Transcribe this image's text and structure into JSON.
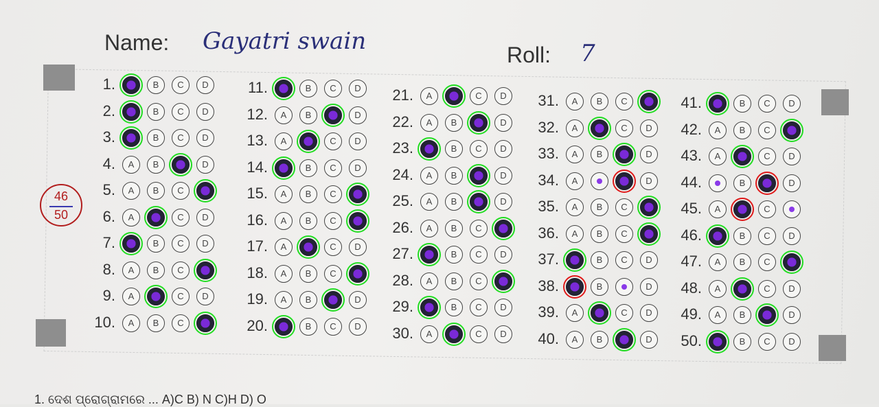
{
  "header": {
    "name_label": "Name:",
    "name_value": "Gayatri swain",
    "roll_label": "Roll:",
    "roll_value": "7"
  },
  "score": {
    "obtained": "46",
    "total": "50"
  },
  "options": [
    "A",
    "B",
    "C",
    "D"
  ],
  "questions": [
    {
      "n": "1.",
      "f": "A",
      "s": "correct"
    },
    {
      "n": "2.",
      "f": "A",
      "s": "correct"
    },
    {
      "n": "3.",
      "f": "A",
      "s": "correct"
    },
    {
      "n": "4.",
      "f": "C",
      "s": "correct"
    },
    {
      "n": "5.",
      "f": "D",
      "s": "correct"
    },
    {
      "n": "6.",
      "f": "B",
      "s": "correct"
    },
    {
      "n": "7.",
      "f": "A",
      "s": "correct"
    },
    {
      "n": "8.",
      "f": "D",
      "s": "correct"
    },
    {
      "n": "9.",
      "f": "B",
      "s": "correct"
    },
    {
      "n": "10.",
      "f": "D",
      "s": "correct"
    },
    {
      "n": "11.",
      "f": "A",
      "s": "correct"
    },
    {
      "n": "12.",
      "f": "C",
      "s": "correct"
    },
    {
      "n": "13.",
      "f": "B",
      "s": "correct"
    },
    {
      "n": "14.",
      "f": "A",
      "s": "correct"
    },
    {
      "n": "15.",
      "f": "D",
      "s": "correct"
    },
    {
      "n": "16.",
      "f": "D",
      "s": "correct"
    },
    {
      "n": "17.",
      "f": "B",
      "s": "correct"
    },
    {
      "n": "18.",
      "f": "D",
      "s": "correct"
    },
    {
      "n": "19.",
      "f": "C",
      "s": "correct"
    },
    {
      "n": "20.",
      "f": "A",
      "s": "correct"
    },
    {
      "n": "21.",
      "f": "B",
      "s": "correct"
    },
    {
      "n": "22.",
      "f": "C",
      "s": "correct"
    },
    {
      "n": "23.",
      "f": "A",
      "s": "correct"
    },
    {
      "n": "24.",
      "f": "C",
      "s": "correct"
    },
    {
      "n": "25.",
      "f": "C",
      "s": "correct"
    },
    {
      "n": "26.",
      "f": "D",
      "s": "correct"
    },
    {
      "n": "27.",
      "f": "A",
      "s": "correct"
    },
    {
      "n": "28.",
      "f": "D",
      "s": "correct"
    },
    {
      "n": "29.",
      "f": "A",
      "s": "correct"
    },
    {
      "n": "30.",
      "f": "B",
      "s": "correct"
    },
    {
      "n": "31.",
      "f": "D",
      "s": "correct"
    },
    {
      "n": "32.",
      "f": "B",
      "s": "correct"
    },
    {
      "n": "33.",
      "f": "C",
      "s": "correct"
    },
    {
      "n": "34.",
      "f": "C",
      "s": "wrong",
      "dot": "B"
    },
    {
      "n": "35.",
      "f": "D",
      "s": "correct"
    },
    {
      "n": "36.",
      "f": "D",
      "s": "correct"
    },
    {
      "n": "37.",
      "f": "A",
      "s": "correct"
    },
    {
      "n": "38.",
      "f": "A",
      "s": "wrong",
      "dot": "C"
    },
    {
      "n": "39.",
      "f": "B",
      "s": "correct"
    },
    {
      "n": "40.",
      "f": "C",
      "s": "correct"
    },
    {
      "n": "41.",
      "f": "A",
      "s": "correct"
    },
    {
      "n": "42.",
      "f": "D",
      "s": "correct"
    },
    {
      "n": "43.",
      "f": "B",
      "s": "correct"
    },
    {
      "n": "44.",
      "f": "C",
      "s": "wrong",
      "dot": "A"
    },
    {
      "n": "45.",
      "f": "B",
      "s": "wrong",
      "dot": "D"
    },
    {
      "n": "46.",
      "f": "A",
      "s": "correct"
    },
    {
      "n": "47.",
      "f": "D",
      "s": "correct"
    },
    {
      "n": "48.",
      "f": "B",
      "s": "correct"
    },
    {
      "n": "49.",
      "f": "C",
      "s": "correct"
    },
    {
      "n": "50.",
      "f": "A",
      "s": "correct"
    }
  ],
  "footer_text": "1. ଦେଶ ପ୍ରୋଗ୍ରାମରେ ... A)C B) N C)H D) O",
  "colors": {
    "correct_ring": "#22dd22",
    "wrong_ring": "#e01a1a",
    "filled": "#232336",
    "ink": "#2a2f78",
    "score": "#b21e1e"
  }
}
